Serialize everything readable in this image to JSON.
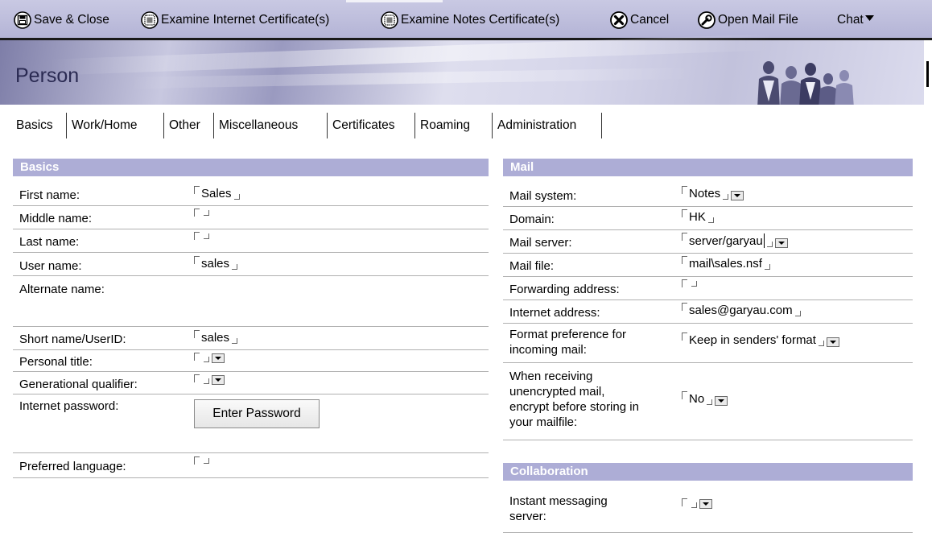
{
  "toolbar": {
    "save_close": "Save & Close",
    "examine_internet": "Examine Internet Certificate(s)",
    "examine_notes": "Examine Notes Certificate(s)",
    "cancel": "Cancel",
    "open_mail_file": "Open Mail File",
    "chat": "Chat"
  },
  "header": {
    "title": "Person"
  },
  "tabs": [
    "Basics",
    "Work/Home",
    "Other",
    "Miscellaneous",
    "Certificates",
    "Roaming",
    "Administration"
  ],
  "basics": {
    "heading": "Basics",
    "first_name": {
      "label": "First name:",
      "value": "Sales"
    },
    "middle_name": {
      "label": "Middle name:",
      "value": ""
    },
    "last_name": {
      "label": "Last name:",
      "value": ""
    },
    "user_name": {
      "label": "User name:",
      "value": "sales"
    },
    "alternate_name": {
      "label": "Alternate name:"
    },
    "short_name": {
      "label": "Short name/UserID:",
      "value": "sales"
    },
    "personal_title": {
      "label": "Personal title:",
      "value": ""
    },
    "generational_qualifier": {
      "label": "Generational qualifier:",
      "value": ""
    },
    "internet_password": {
      "label": "Internet password:",
      "button": "Enter Password"
    },
    "preferred_language": {
      "label": "Preferred language:",
      "value": ""
    }
  },
  "mail": {
    "heading": "Mail",
    "mail_system": {
      "label": "Mail system:",
      "value": "Notes"
    },
    "domain": {
      "label": "Domain:",
      "value": "HK"
    },
    "mail_server": {
      "label": "Mail server:",
      "value": "server/garyau"
    },
    "mail_file": {
      "label": "Mail file:",
      "value": "mail\\sales.nsf"
    },
    "forwarding_address": {
      "label": "Forwarding address:",
      "value": ""
    },
    "internet_address": {
      "label": "Internet address:",
      "value": "sales@garyau.com"
    },
    "format_preference": {
      "label_line1": "Format preference for",
      "label_line2": "incoming mail:",
      "value": "Keep in senders' format"
    },
    "encrypt": {
      "label_line1": "When receiving",
      "label_line2": "unencrypted mail,",
      "label_line3": "encrypt before storing in",
      "label_line4": "your mailfile:",
      "value": "No"
    }
  },
  "collaboration": {
    "heading": "Collaboration",
    "im_server": {
      "label_line1": "Instant messaging",
      "label_line2": "server:",
      "value": ""
    }
  },
  "colors": {
    "toolbar_bg": "#b4b4d6",
    "section_header": "#adadd6",
    "title": "#2a2a52"
  }
}
